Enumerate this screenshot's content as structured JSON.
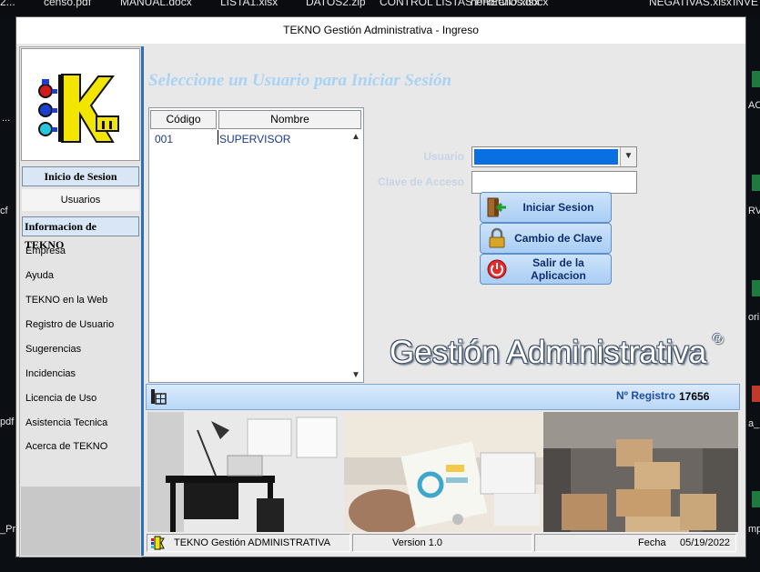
{
  "desktop": {
    "top_files": [
      "2...",
      "censo.pdf",
      "MANUAL.docx",
      "LISTA1.xlsx",
      "DATOS2.zip",
      "CONTROL LISTAS PRECIO.xlsx",
      "honorarios.docx",
      "NEGATIVAS.xlsx",
      "INVE"
    ],
    "side_left": [
      "...",
      "cf",
      "pdf",
      "_Pr..."
    ],
    "side_right": [
      "ACI",
      "RVI",
      "ori",
      "a_",
      "mp"
    ]
  },
  "window": {
    "title": "TEKNO Gestión Administrativa - Ingreso"
  },
  "sidebar": {
    "section_login": "Inicio de Sesion",
    "login_items": [
      "Usuarios"
    ],
    "section_info": "Informacion de TEKNO",
    "info_items": [
      "Empresa",
      "Ayuda",
      "TEKNO en la Web",
      "Registro de Usuario",
      "Sugerencias",
      "Incidencias",
      "Licencia de Uso",
      "Asistencia Tecnica",
      "Acerca de TEKNO"
    ]
  },
  "main": {
    "heading": "Seleccione un Usuario para Iniciar Sesión",
    "user_table": {
      "columns": [
        "Código",
        "Nombre"
      ],
      "rows": [
        {
          "code": "001",
          "name": "SUPERVISOR"
        }
      ]
    },
    "form": {
      "user_label": "Usuario",
      "user_value": "",
      "password_label": "Clave de Acceso",
      "password_value": ""
    },
    "buttons": {
      "login": "Iniciar Sesion",
      "change_password": "Cambio de Clave",
      "exit": "Salir de la Aplicacion"
    },
    "brand_text": "Gestión Administrativa",
    "brand_mark": "®",
    "registration_label": "Nº Registro",
    "registration_value": "17656"
  },
  "statusbar": {
    "app_name": "TEKNO Gestión ADMINISTRATIVA",
    "version": "Version 1.0",
    "date_label": "Fecha",
    "date_value": "05/19/2022"
  },
  "colors": {
    "accent": "#2f6fb5",
    "heading": "#a9d3f5",
    "selection": "#0a6fe0",
    "button_text": "#0f2d6e",
    "logo_yellow": "#f2e600"
  },
  "icons": {
    "login_button": "exit-door-arrow-icon",
    "change_password_button": "padlock-icon",
    "exit_button": "power-icon",
    "regbar": "building-grid-icon",
    "statusbar": "tekno-logo-icon",
    "list_scroll_up": "chevron-up-icon",
    "list_scroll_down": "chevron-down-icon",
    "combo": "chevron-down-icon"
  }
}
